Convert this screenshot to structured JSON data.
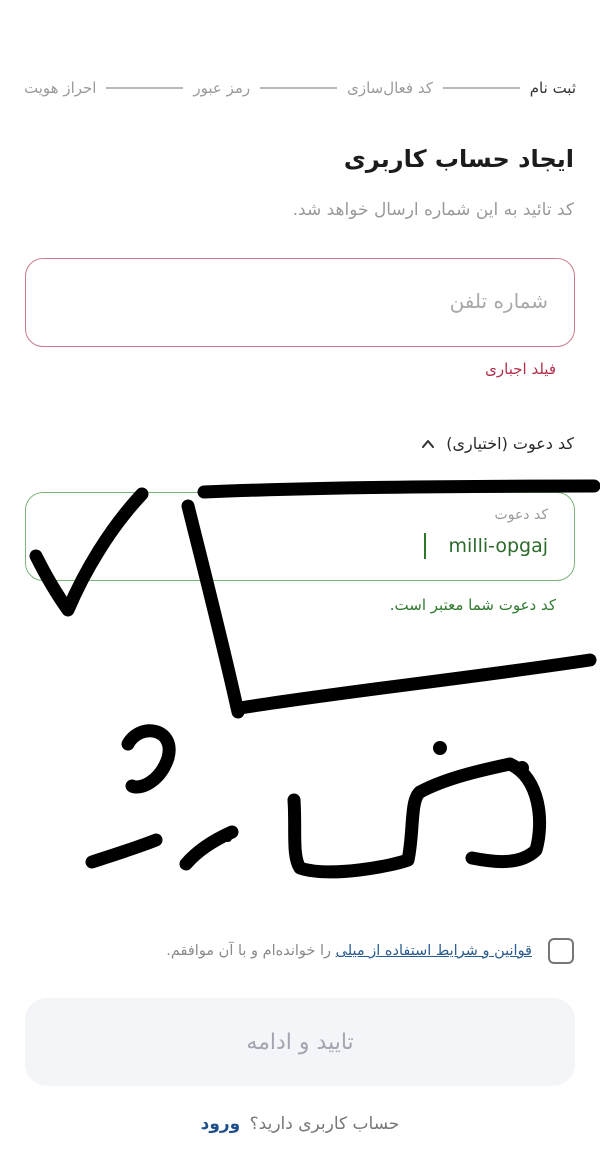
{
  "stepper": {
    "steps": [
      "ثبت نام",
      "کد فعال‌سازی",
      "رمز عبور",
      "احراز هویت"
    ],
    "active_index": 0
  },
  "header": {
    "title": "ایجاد حساب کاربری",
    "subtitle": "کد تائید به این شماره ارسال خواهد شد."
  },
  "phone": {
    "placeholder": "شماره تلفن",
    "value": "",
    "error": "فیلد اجباری"
  },
  "invite": {
    "toggle_label": "کد دعوت (اختیاری)",
    "expanded": true,
    "field_label": "کد دعوت",
    "value": "milli-opgaj",
    "success": "کد دعوت شما معتبر است."
  },
  "terms": {
    "checked": false,
    "link_text": "قوانین و شرایط استفاده از میلی",
    "suffix_text": "را خوانده‌ام و با آن موافقم."
  },
  "actions": {
    "submit_label": "تایید و ادامه"
  },
  "footer": {
    "question": "حساب کاربری دارید؟",
    "login_label": "ورود"
  },
  "colors": {
    "error": "#b0304a",
    "success": "#2f7a2f",
    "link": "#1f4f8a",
    "disabled_bg": "#f4f5f9"
  }
}
